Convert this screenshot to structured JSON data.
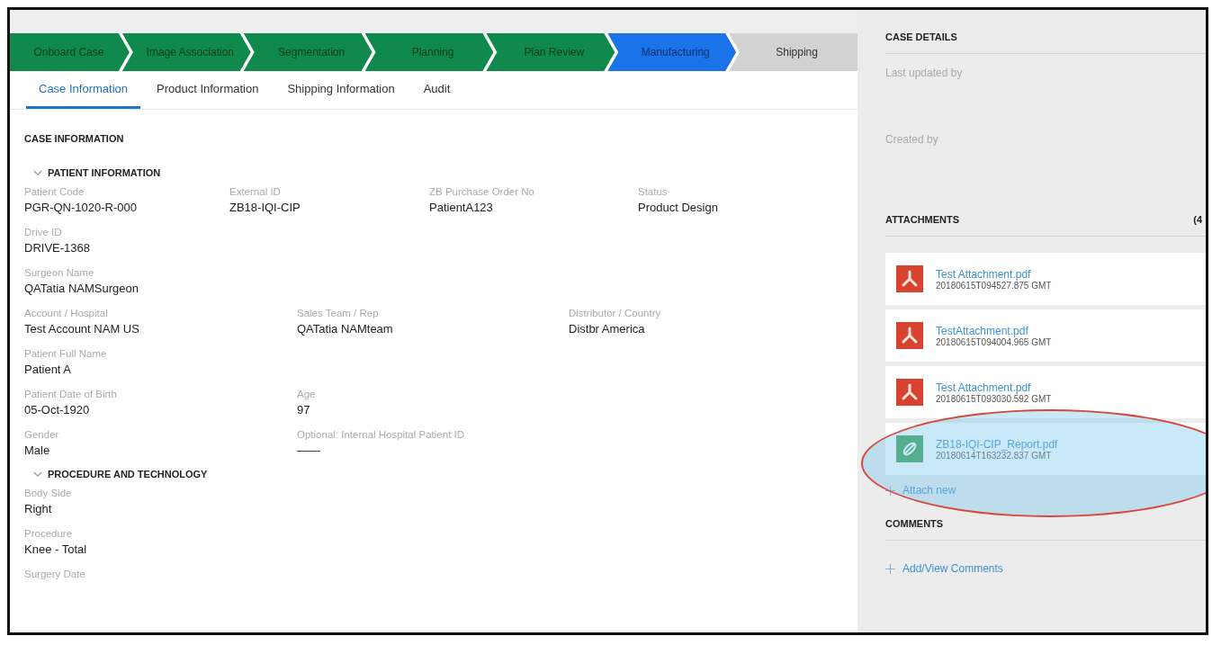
{
  "stages": [
    {
      "label": "Onboard Case",
      "kind": "done"
    },
    {
      "label": "Image Association",
      "kind": "done"
    },
    {
      "label": "Segmentation",
      "kind": "done"
    },
    {
      "label": "Planning",
      "kind": "done"
    },
    {
      "label": "Plan Review",
      "kind": "done"
    },
    {
      "label": "Manufacturing",
      "kind": "current"
    },
    {
      "label": "Shipping",
      "kind": "pending"
    }
  ],
  "tabs": [
    {
      "label": "Case Information",
      "selected": true
    },
    {
      "label": "Product Information",
      "selected": false
    },
    {
      "label": "Shipping Information",
      "selected": false
    },
    {
      "label": "Audit",
      "selected": false
    }
  ],
  "case_information": {
    "title": "CASE INFORMATION",
    "sections": [
      {
        "title": "PATIENT INFORMATION",
        "expanded": true,
        "rows": [
          [
            {
              "label": "Patient Code",
              "value": "PGR-QN-1020-R-000"
            },
            {
              "label": "External ID",
              "value": "ZB18-IQI-CIP"
            },
            {
              "label": "ZB Purchase Order No",
              "value": "PatientA123"
            },
            {
              "label": "Status",
              "value": "Product Design"
            }
          ],
          [
            {
              "label": "Drive ID",
              "value": "DRIVE-1368"
            }
          ],
          [
            {
              "label": "Surgeon Name",
              "value": "QATatia NAMSurgeon"
            }
          ],
          [
            {
              "label": "Account / Hospital",
              "value": "Test Account NAM US"
            },
            {
              "label": "Sales Team / Rep",
              "value": "QATatia NAMteam"
            },
            {
              "label": "Distributor / Country",
              "value": "Distbr America"
            }
          ],
          [
            {
              "label": "Patient Full Name",
              "value": "Patient A"
            }
          ],
          [
            {
              "label": "Patient Date of Birth",
              "value": "05-Oct-1920"
            },
            {
              "label": "Age",
              "value": "97"
            }
          ],
          [
            {
              "label": "Gender",
              "value": "Male"
            },
            {
              "label": "Optional: Internal Hospital Patient ID",
              "value": "——"
            }
          ]
        ]
      },
      {
        "title": "PROCEDURE AND TECHNOLOGY",
        "expanded": true,
        "rows": [
          [
            {
              "label": "Body Side",
              "value": "Right"
            }
          ],
          [
            {
              "label": "Procedure",
              "value": "Knee - Total"
            }
          ],
          [
            {
              "label": "Surgery Date"
            }
          ]
        ]
      }
    ]
  },
  "case_details": {
    "title": "CASE DETAILS",
    "fields": [
      "Last updated by",
      "Created by"
    ]
  },
  "attachments": {
    "title": "ATTACHMENTS",
    "count": "(4",
    "items": [
      {
        "name": "Test Attachment.pdf",
        "timestamp": "20180615T094527.875 GMT",
        "kind": "pdf"
      },
      {
        "name": "TestAttachment.pdf",
        "timestamp": "20180615T094004.965 GMT",
        "kind": "pdf"
      },
      {
        "name": "Test Attachment.pdf",
        "timestamp": "20180615T093030.592 GMT",
        "kind": "pdf"
      },
      {
        "name": "ZB18-IQI-CIP_Report.pdf",
        "timestamp": "20180614T163232.837 GMT",
        "kind": "report"
      }
    ],
    "attach_new": "Attach new"
  },
  "comments": {
    "title": "COMMENTS",
    "link": "Add/View Comments"
  }
}
